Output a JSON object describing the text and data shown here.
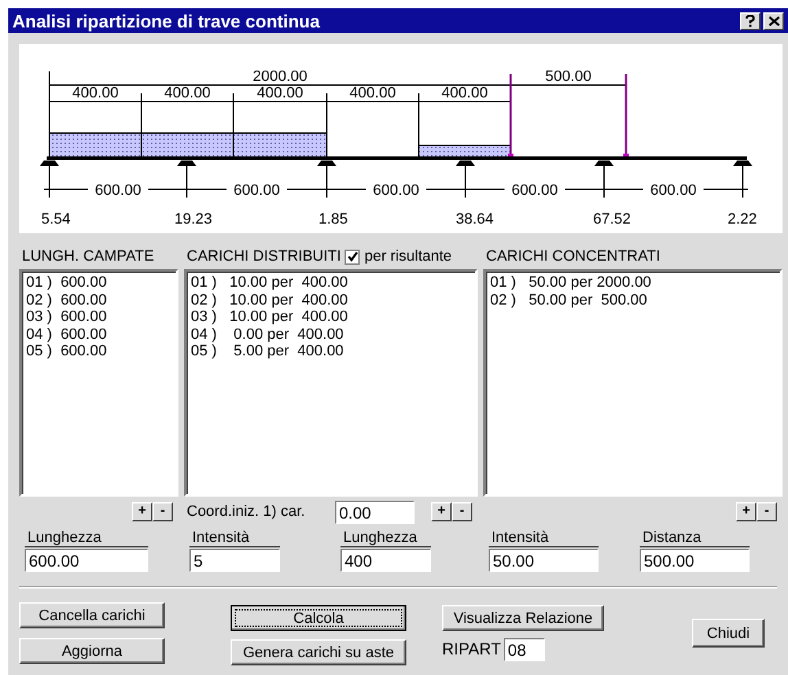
{
  "window": {
    "title": "Analisi ripartizione di trave continua"
  },
  "diagram": {
    "total_label": "2000.00",
    "concentrated_label": "500.00",
    "segments": [
      {
        "label": "400.00",
        "kind": "full"
      },
      {
        "label": "400.00",
        "kind": "full"
      },
      {
        "label": "400.00",
        "kind": "full"
      },
      {
        "label": "400.00",
        "kind": "empty"
      },
      {
        "label": "400.00",
        "kind": "half"
      }
    ],
    "span_labels": [
      "600.00",
      "600.00",
      "600.00",
      "600.00",
      "600.00"
    ],
    "reaction_labels": [
      "5.54",
      "19.23",
      "1.85",
      "38.64",
      "67.52",
      "2.22"
    ]
  },
  "spans": {
    "title": "LUNGH. CAMPATE",
    "items": [
      "01 )  600.00",
      "02 )  600.00",
      "03 )  600.00",
      "04 )  600.00",
      "05 )  600.00"
    ],
    "add_button": "+",
    "remove_button": "-",
    "field": {
      "label": "Lunghezza",
      "value": "600.00"
    }
  },
  "distributed": {
    "title": "CARICHI DISTRIBUITI",
    "checkbox": {
      "label": "per risultante",
      "checked": true
    },
    "items": [
      "01 )   10.00 per  400.00",
      "02 )   10.00 per  400.00",
      "03 )   10.00 per  400.00",
      "04 )    0.00 per  400.00",
      "05 )    5.00 per  400.00"
    ],
    "coord_label": "Coord.iniz. 1) car.",
    "coord_value": "0.00",
    "add_button": "+",
    "remove_button": "-",
    "fields": [
      {
        "label": "Intensità",
        "value": "5"
      },
      {
        "label": "Lunghezza",
        "value": "400"
      }
    ]
  },
  "concentrated": {
    "title": "CARICHI CONCENTRATI",
    "items": [
      "01 )   50.00 per 2000.00",
      "02 )   50.00 per  500.00"
    ],
    "add_button": "+",
    "remove_button": "-",
    "fields": [
      {
        "label": "Intensità",
        "value": "50.00"
      },
      {
        "label": "Distanza",
        "value": "500.00"
      }
    ]
  },
  "buttons": {
    "clear": "Cancella carichi",
    "update": "Aggiorna",
    "compute": {
      "label": "Calcola",
      "focused": true
    },
    "generate": "Genera carichi su aste",
    "report": "Visualizza Relazione",
    "close": "Chiudi"
  },
  "ripart": {
    "label": "RIPART",
    "value": "08"
  }
}
